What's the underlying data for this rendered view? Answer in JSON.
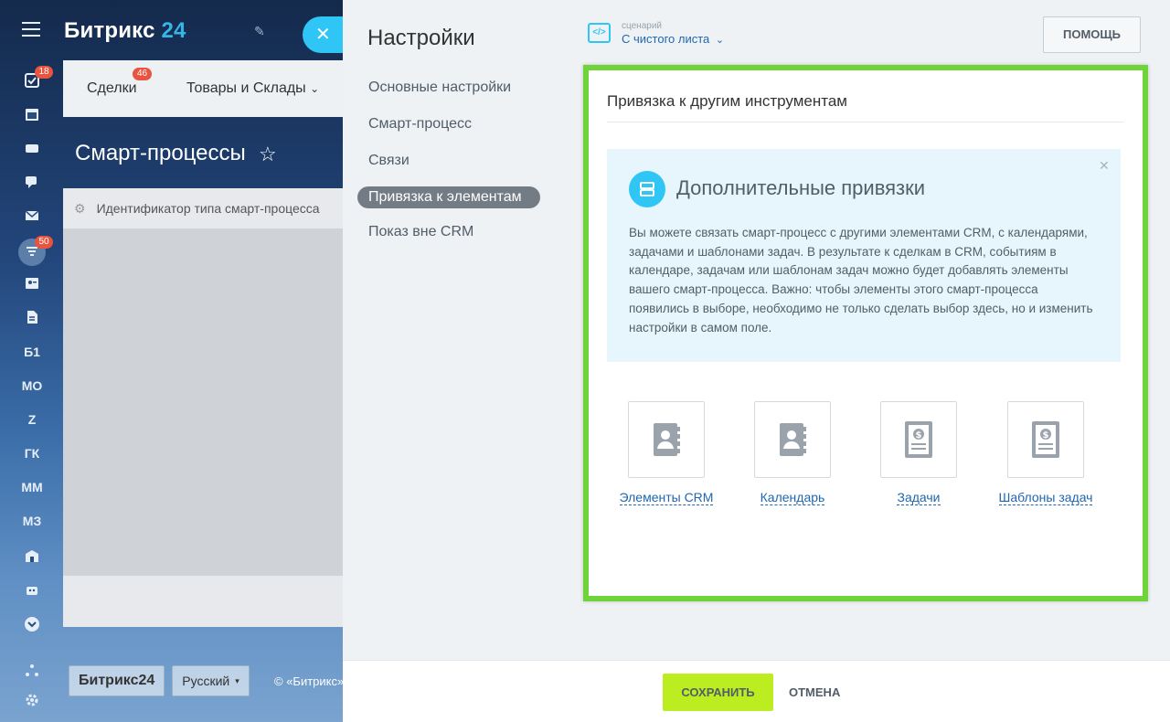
{
  "background": {
    "logo_text": "Битрикс",
    "logo_num": "24",
    "rail": {
      "badge_tasks": "18",
      "badge_funnel": "50",
      "letters": [
        "Б1",
        "МО",
        "Z",
        "ГК",
        "ММ",
        "МЗ"
      ]
    },
    "tabs": [
      {
        "label": "Сделки",
        "badge": "46"
      },
      {
        "label": "Товары и Склады"
      }
    ],
    "page_title": "Смарт-процессы",
    "table_header": "Идентификатор типа смарт-процесса",
    "footer": {
      "logo": "Битрикс24",
      "language": "Русский",
      "copyright": "© «Битрикс»"
    }
  },
  "slider": {
    "title": "Настройки",
    "scenario_caption": "сценарий",
    "scenario_value": "С чистого листа",
    "help_label": "ПОМОЩЬ",
    "nav": [
      {
        "label": "Основные настройки"
      },
      {
        "label": "Смарт-процесс"
      },
      {
        "label": "Связи"
      },
      {
        "label": "Привязка к элементам",
        "active": true
      },
      {
        "label": "Показ вне CRM"
      }
    ]
  },
  "card": {
    "title": "Привязка к другим инструментам",
    "info": {
      "title": "Дополнительные привязки",
      "text": "Вы можете связать смарт-процесс с другими элементами CRM, с календарями, задачами и шаблонами задач. В результате к сделкам в CRM, событиям в календаре, задачам или шаблонам задач можно будет добавлять элементы вашего смарт-процесса. Важно: чтобы элементы этого смарт-процесса появились в выборе, необходимо не только сделать выбор здесь, но и изменить настройки в самом поле."
    },
    "tiles": [
      {
        "label": "Элементы CRM",
        "icon": "contact-book-icon"
      },
      {
        "label": "Календарь",
        "icon": "contact-book-icon"
      },
      {
        "label": "Задачи",
        "icon": "invoice-icon"
      },
      {
        "label": "Шаблоны задач",
        "icon": "invoice-icon"
      }
    ]
  },
  "footer_bar": {
    "save_label": "СОХРАНИТЬ",
    "cancel_label": "ОТМЕНА"
  },
  "colors": {
    "accent": "#2fc6f6",
    "highlight_frame": "#6fd33a",
    "save": "#bbed21",
    "link": "#2067b0"
  }
}
